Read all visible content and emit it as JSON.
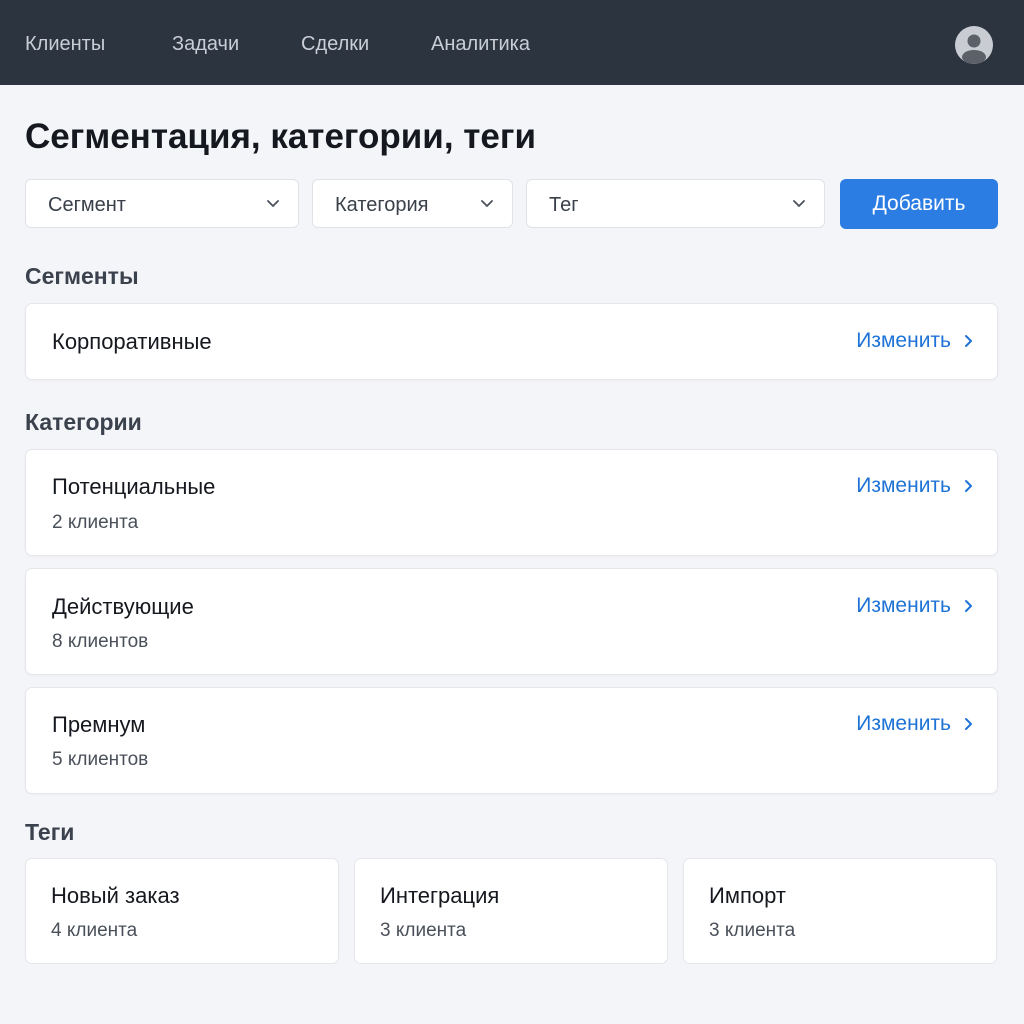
{
  "nav": {
    "items": [
      {
        "label": "Клиенты"
      },
      {
        "label": "Задачи"
      },
      {
        "label": "Сделки"
      },
      {
        "label": "Аналитика"
      }
    ],
    "avatar_icon": "user-avatar-icon"
  },
  "page": {
    "title": "Сегментация, категории, теги"
  },
  "filters": {
    "segment": {
      "label": "Сегмент"
    },
    "category": {
      "label": "Категория"
    },
    "tag": {
      "label": "Тег"
    },
    "add_button": "Добавить"
  },
  "segments": {
    "heading": "Сегменты",
    "items": [
      {
        "name": "Корпоративные",
        "action": "Изменить"
      }
    ]
  },
  "categories": {
    "heading": "Категории",
    "items": [
      {
        "name": "Потенциальные",
        "count": "2 клиента",
        "action": "Изменить"
      },
      {
        "name": "Действующие",
        "count": "8 клиентов",
        "action": "Изменить"
      },
      {
        "name": "Премнум",
        "count": "5 клиентов",
        "action": "Изменить"
      }
    ]
  },
  "tags": {
    "heading": "Теги",
    "items": [
      {
        "name": "Новый заказ",
        "count": "4 клиента"
      },
      {
        "name": "Интеграция",
        "count": "3 клиента"
      },
      {
        "name": "Импорт",
        "count": "3 клиента"
      }
    ]
  },
  "colors": {
    "topbar": "#2c3440",
    "accent": "#2b7de3",
    "link": "#1f73d6",
    "background": "#f4f5f8"
  }
}
